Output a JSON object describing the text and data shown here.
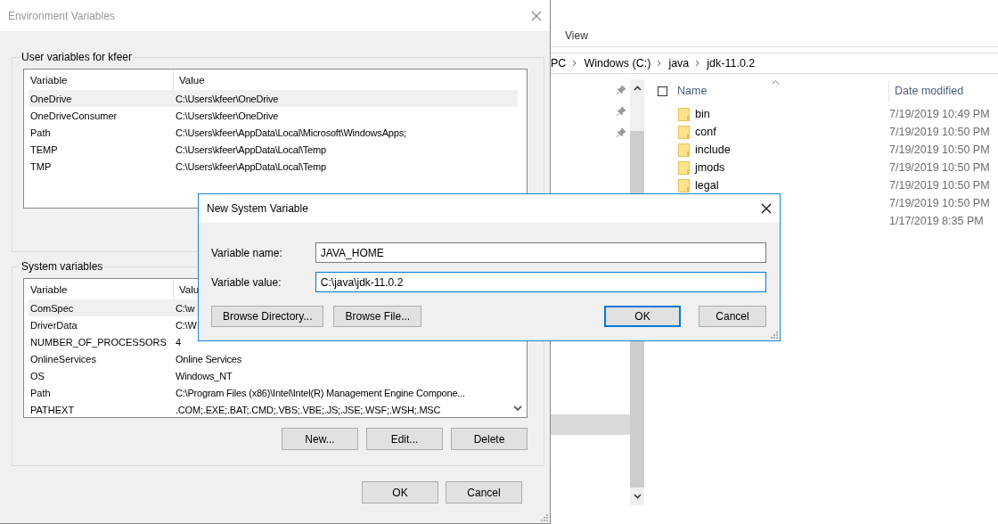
{
  "explorer": {
    "ribbon_tabs": [
      {
        "label": "View"
      }
    ],
    "breadcrumb": [
      "PC",
      "Windows (C:)",
      "java",
      "jdk-11.0.2"
    ],
    "select_all": {
      "checked": false
    },
    "columns": [
      "Name",
      "Date modified"
    ],
    "files": [
      {
        "name": "bin",
        "date": "7/19/2019 10:49 PM"
      },
      {
        "name": "conf",
        "date": "7/19/2019 10:50 PM"
      },
      {
        "name": "include",
        "date": "7/19/2019 10:50 PM"
      },
      {
        "name": "jmods",
        "date": "7/19/2019 10:50 PM"
      },
      {
        "name": "legal",
        "date": "7/19/2019 10:50 PM"
      },
      {
        "date": "7/19/2019 10:50 PM"
      },
      {
        "date": "1/17/2019 8:35 PM"
      }
    ]
  },
  "environment_dialog": {
    "title": "Environment Variables",
    "active": false,
    "user_group": {
      "title": "User variables for kfeer",
      "columns": [
        "Variable",
        "Value"
      ],
      "rows": [
        {
          "variable": "OneDrive",
          "value": "C:\\Users\\kfeer\\OneDrive",
          "selected": true
        },
        {
          "variable": "OneDriveConsumer",
          "value": "C:\\Users\\kfeer\\OneDrive",
          "selected": false
        },
        {
          "variable": "Path",
          "value": "C:\\Users\\kfeer\\AppData\\Local\\Microsoft\\WindowsApps;",
          "selected": false
        },
        {
          "variable": "TEMP",
          "value": "C:\\Users\\kfeer\\AppData\\Local\\Temp",
          "selected": false
        },
        {
          "variable": "TMP",
          "value": "C:\\Users\\kfeer\\AppData\\Local\\Temp",
          "selected": false
        }
      ]
    },
    "system_group": {
      "title": "System variables",
      "columns": [
        "Variable",
        "Valu"
      ],
      "rows": [
        {
          "variable": "ComSpec",
          "value": "C:\\w",
          "selected": true
        },
        {
          "variable": "DriverData",
          "value": "C:\\W",
          "selected": false
        },
        {
          "variable": "NUMBER_OF_PROCESSORS",
          "value": "4",
          "selected": false
        },
        {
          "variable": "OnlineServices",
          "value": "Online Services",
          "selected": false
        },
        {
          "variable": "OS",
          "value": "Windows_NT",
          "selected": false
        },
        {
          "variable": "Path",
          "value": "C:\\Program Files (x86)\\Intel\\Intel(R) Management Engine Compone...",
          "selected": false
        },
        {
          "variable": "PATHEXT",
          "value": ".COM;.EXE;.BAT;.CMD;.VBS;.VBE;.JS;.JSE;.WSF;.WSH;.MSC",
          "selected": false
        }
      ],
      "buttons": [
        "New...",
        "Edit...",
        "Delete"
      ]
    },
    "footer_buttons": [
      "OK",
      "Cancel"
    ]
  },
  "new_variable_dialog": {
    "title": "New System Variable",
    "active": true,
    "fields": [
      {
        "label": "Variable name:",
        "value": "JAVA_HOME",
        "focused": false
      },
      {
        "label": "Variable value:",
        "value": "C:\\java\\jdk-11.0.2",
        "focused": true
      }
    ],
    "browse_buttons": [
      "Browse Directory...",
      "Browse File..."
    ],
    "buttons": [
      {
        "label": "OK",
        "default": true
      },
      {
        "label": "Cancel",
        "default": false
      }
    ]
  }
}
